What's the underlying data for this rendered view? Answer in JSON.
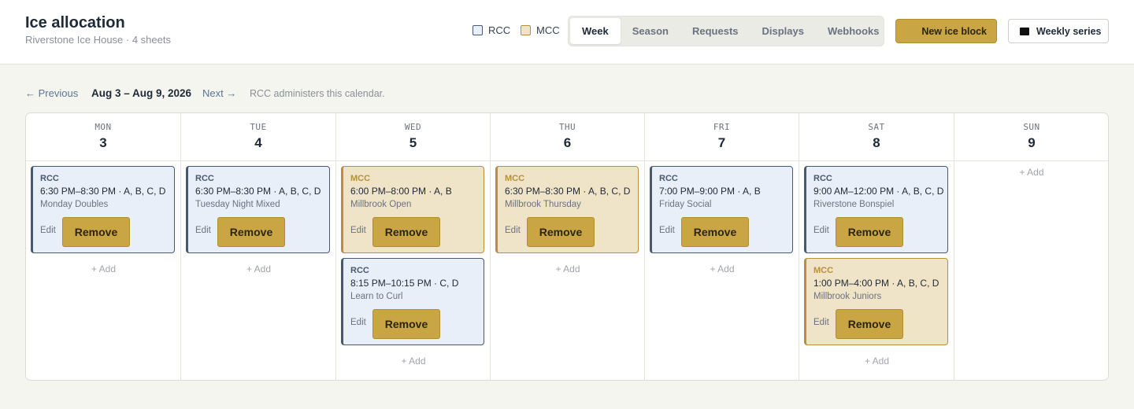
{
  "header": {
    "title": "Ice allocation",
    "subtitle": "Riverstone Ice House · 4 sheets"
  },
  "legend": [
    {
      "label": "RCC",
      "color": "#e9eff8",
      "border": "#47596e"
    },
    {
      "label": "MCC",
      "color": "#efe3c8",
      "border": "#b88f3a"
    }
  ],
  "tabs": [
    {
      "label": "Week",
      "active": true
    },
    {
      "label": "Season",
      "active": false
    },
    {
      "label": "Requests",
      "active": false
    },
    {
      "label": "Displays",
      "active": false
    },
    {
      "label": "Webhooks",
      "active": false
    }
  ],
  "actions": {
    "new_block": "New ice block",
    "weekly_series": "Weekly series"
  },
  "week_nav": {
    "previous": "← Previous",
    "range": "Aug 3 – Aug 9, 2026",
    "next": "Next →",
    "note": "RCC administers this calendar."
  },
  "colors": {
    "accent": "#c9a543",
    "rcc": "#47596e",
    "mcc": "#b88f3a"
  },
  "labels": {
    "edit": "Edit",
    "remove": "Remove",
    "add": "+ Add"
  },
  "days": [
    {
      "name": "MON",
      "num": "3",
      "blocks": [
        {
          "org": "RCC",
          "time": "6:30 PM–8:30 PM · A, B, C, D",
          "name": "Monday Doubles"
        }
      ]
    },
    {
      "name": "TUE",
      "num": "4",
      "blocks": [
        {
          "org": "RCC",
          "time": "6:30 PM–8:30 PM · A, B, C, D",
          "name": "Tuesday Night Mixed"
        }
      ]
    },
    {
      "name": "WED",
      "num": "5",
      "blocks": [
        {
          "org": "MCC",
          "time": "6:00 PM–8:00 PM · A, B",
          "name": "Millbrook Open"
        },
        {
          "org": "RCC",
          "time": "8:15 PM–10:15 PM · C, D",
          "name": "Learn to Curl"
        }
      ]
    },
    {
      "name": "THU",
      "num": "6",
      "blocks": [
        {
          "org": "MCC",
          "time": "6:30 PM–8:30 PM · A, B, C, D",
          "name": "Millbrook Thursday"
        }
      ]
    },
    {
      "name": "FRI",
      "num": "7",
      "blocks": [
        {
          "org": "RCC",
          "time": "7:00 PM–9:00 PM · A, B",
          "name": "Friday Social"
        }
      ]
    },
    {
      "name": "SAT",
      "num": "8",
      "blocks": [
        {
          "org": "RCC",
          "time": "9:00 AM–12:00 PM · A, B, C, D",
          "name": "Riverstone Bonspiel"
        },
        {
          "org": "MCC",
          "time": "1:00 PM–4:00 PM · A, B, C, D",
          "name": "Millbrook Juniors"
        }
      ]
    },
    {
      "name": "SUN",
      "num": "9",
      "blocks": []
    }
  ]
}
